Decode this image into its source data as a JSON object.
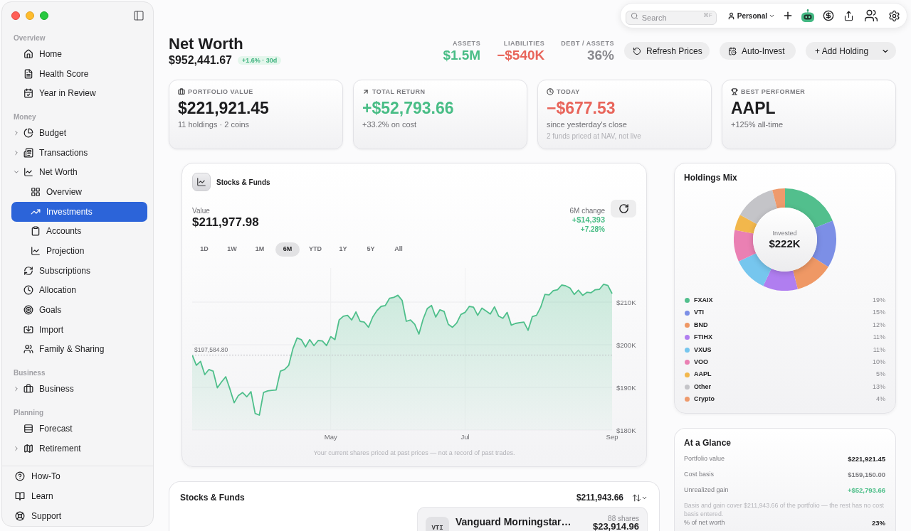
{
  "sidebar": {
    "sections": [
      {
        "title": "Overview",
        "items": [
          {
            "label": "Home",
            "selected": false
          },
          {
            "label": "Health Score",
            "selected": false
          },
          {
            "label": "Year in Review",
            "selected": false
          }
        ]
      },
      {
        "title": "Money",
        "items": [
          {
            "label": "Budget",
            "selected": false,
            "expanded": false
          },
          {
            "label": "Transactions",
            "selected": false,
            "expanded": false
          },
          {
            "label": "Net Worth",
            "selected": false,
            "expanded": true,
            "children": [
              {
                "label": "Overview",
                "selected": false
              },
              {
                "label": "Investments",
                "selected": true
              },
              {
                "label": "Accounts",
                "selected": false
              },
              {
                "label": "Projection",
                "selected": false
              }
            ]
          },
          {
            "label": "Subscriptions",
            "selected": false
          },
          {
            "label": "Allocation",
            "selected": false
          },
          {
            "label": "Goals",
            "selected": false
          },
          {
            "label": "Import",
            "selected": false
          },
          {
            "label": "Family & Sharing",
            "selected": false
          }
        ]
      },
      {
        "title": "Business",
        "items": [
          {
            "label": "Business",
            "selected": false,
            "expanded": false
          }
        ]
      },
      {
        "title": "Planning",
        "items": [
          {
            "label": "Forecast",
            "selected": false
          },
          {
            "label": "Retirement",
            "selected": false,
            "expanded": false
          }
        ]
      }
    ],
    "footer": [
      {
        "label": "How-To"
      },
      {
        "label": "Learn"
      },
      {
        "label": "Support"
      }
    ]
  },
  "toolbar": {
    "search": {
      "placeholder": "Search",
      "shortcut": "⌘F"
    },
    "profile": {
      "label": "Personal"
    }
  },
  "header": {
    "title": "Net Worth",
    "total": "$952,441.67",
    "change_badge": "+1.6% · 30d",
    "stats": [
      {
        "label": "ASSETS",
        "value": "$1.5M",
        "color": "#49bd86"
      },
      {
        "label": "LIABILITIES",
        "value": "−$540K",
        "color": "#e8655b"
      },
      {
        "label": "DEBT / ASSETS",
        "value": "36%",
        "color": "#8a8a8f"
      }
    ],
    "actions": [
      {
        "label": "Refresh Prices",
        "kind": "refresh"
      },
      {
        "label": "Auto-Invest",
        "kind": "schedule"
      },
      {
        "label": "+ Add Holding",
        "kind": "menu"
      }
    ]
  },
  "summary_cards": [
    {
      "label": "PORTFOLIO VALUE",
      "value": "$221,921.45",
      "color": "#1d1d1f",
      "detail": "11 holdings · 2 coins"
    },
    {
      "label": "TOTAL RETURN",
      "value": "+$52,793.66",
      "color": "#49bd86",
      "detail": "+33.2% on cost"
    },
    {
      "label": "TODAY",
      "value": "−$677.53",
      "color": "#e8655b",
      "detail": "since yesterday's close",
      "footnote": "2 funds priced at NAV, not live"
    },
    {
      "label": "BEST PERFORMER",
      "value": "AAPL",
      "color": "#1d1d1f",
      "detail": "+125% all-time"
    }
  ],
  "performance": {
    "title": "Stocks & Funds",
    "value_label": "Value",
    "value": "$211,977.98",
    "change_label": "6M change",
    "change_amount": "+$14,393",
    "change_percent": "+7.28%",
    "ranges": [
      {
        "label": "1D",
        "selected": false
      },
      {
        "label": "1W",
        "selected": false
      },
      {
        "label": "1M",
        "selected": false
      },
      {
        "label": "6M",
        "selected": true
      },
      {
        "label": "YTD",
        "selected": false
      },
      {
        "label": "1Y",
        "selected": false
      },
      {
        "label": "5Y",
        "selected": false
      },
      {
        "label": "All",
        "selected": false
      }
    ],
    "chart_data": {
      "type": "area",
      "grid": true,
      "categories": [
        null,
        null,
        null,
        null,
        null,
        null,
        null,
        null,
        null,
        null,
        null,
        null,
        null,
        null,
        null,
        null,
        null,
        null,
        null,
        null,
        null,
        null,
        null,
        null,
        null,
        null,
        null,
        null,
        null,
        null,
        null,
        null,
        null,
        "May",
        null,
        null,
        null,
        null,
        null,
        null,
        null,
        null,
        null,
        null,
        null,
        null,
        null,
        null,
        null,
        null,
        null,
        null,
        null,
        null,
        null,
        null,
        null,
        null,
        null,
        null,
        null,
        null,
        null,
        null,
        null,
        "Jul",
        null,
        null,
        null,
        null,
        null,
        null,
        null,
        null,
        null,
        null,
        null,
        null,
        null,
        null,
        null,
        null,
        null,
        null,
        null,
        null,
        null,
        null,
        null,
        null,
        null,
        null,
        null,
        null,
        null,
        null,
        null,
        null,
        null,
        null,
        "Sep"
      ],
      "series": [
        {
          "color": "#4fbf8b",
          "values": [
            197600,
            195200,
            196100,
            193000,
            194200,
            193800,
            189900,
            191300,
            192500,
            189600,
            186400,
            188100,
            188800,
            187800,
            189000,
            183900,
            183500,
            188800,
            189200,
            189300,
            189400,
            193800,
            194200,
            195200,
            199100,
            201600,
            201200,
            199500,
            201200,
            199800,
            201000,
            200900,
            199800,
            201900,
            201200,
            205800,
            206700,
            206900,
            205800,
            207700,
            205500,
            205300,
            204100,
            206500,
            208000,
            209000,
            209200,
            210900,
            211100,
            211600,
            210400,
            205500,
            205800,
            204800,
            202500,
            206000,
            208500,
            209200,
            206500,
            208200,
            207800,
            204800,
            204100,
            205100,
            207100,
            207600,
            209000,
            208800,
            206900,
            208600,
            207900,
            207200,
            208900,
            206700,
            206200,
            207600,
            204600,
            205000,
            205200,
            205300,
            203400,
            206600,
            206900,
            208800,
            211800,
            211700,
            212700,
            212900,
            214000,
            213800,
            213300,
            211800,
            212800,
            211600,
            212300,
            212200,
            212900,
            213000,
            214200,
            213900,
            212000
          ]
        }
      ],
      "ylim": [
        180000,
        218000
      ],
      "yticks": [
        {
          "value": 180000,
          "label": "$180K"
        },
        {
          "value": 190000,
          "label": "$190K"
        },
        {
          "value": 200000,
          "label": "$200K"
        },
        {
          "value": 210000,
          "label": "$210K"
        }
      ],
      "ref_lines": [
        {
          "axis": "y",
          "value": 197584.8,
          "label": "$197,584.80"
        }
      ]
    },
    "caption": "Your current shares priced at past prices — not a record of past trades."
  },
  "holdings_mix": {
    "title": "Holdings Mix",
    "center_label": "Invested",
    "center_value": "$222K",
    "chart_data": {
      "type": "donut",
      "values": [
        19,
        15,
        12,
        11,
        11,
        10,
        5,
        13,
        4
      ]
    },
    "legend": [
      {
        "name": "FXAIX",
        "share": "19%",
        "color": "#52bf8d"
      },
      {
        "name": "VTI",
        "share": "15%",
        "color": "#7c8fe6"
      },
      {
        "name": "BND",
        "share": "12%",
        "color": "#ef9865"
      },
      {
        "name": "FTIHX",
        "share": "11%",
        "color": "#b07ef0"
      },
      {
        "name": "VXUS",
        "share": "11%",
        "color": "#76c6ee"
      },
      {
        "name": "VOO",
        "share": "10%",
        "color": "#ea80b3"
      },
      {
        "name": "AAPL",
        "share": "5%",
        "color": "#f2b74c"
      },
      {
        "name": "Other",
        "share": "13%",
        "color": "#c4c4c8"
      },
      {
        "name": "Crypto",
        "share": "4%",
        "color": "#ee9a6c"
      }
    ]
  },
  "at_a_glance": {
    "title": "At a Glance",
    "items": [
      {
        "kind": "row",
        "label": "Portfolio value",
        "value": "$221,921.45",
        "color": "#1d1d1f"
      },
      {
        "kind": "row",
        "label": "Cost basis",
        "value": "$159,150.00",
        "color": "#7c7c80"
      },
      {
        "kind": "row",
        "label": "Unrealized gain",
        "value": "+$52,793.66",
        "color": "#49bd86"
      },
      {
        "kind": "note",
        "text": "Basis and gain cover $211,943.66 of the portfolio — the rest has no cost basis entered."
      },
      {
        "kind": "row",
        "label": "% of net worth",
        "value": "23%",
        "color": "#1d1d1f"
      }
    ]
  },
  "holdings_list": {
    "title": "Stocks & Funds",
    "total": "$211,943.66",
    "holdings": [
      {
        "ticker": "VTI",
        "name": "Vanguard Morningstar…",
        "shares": "88 shares",
        "value": "$23,914.96"
      }
    ]
  }
}
